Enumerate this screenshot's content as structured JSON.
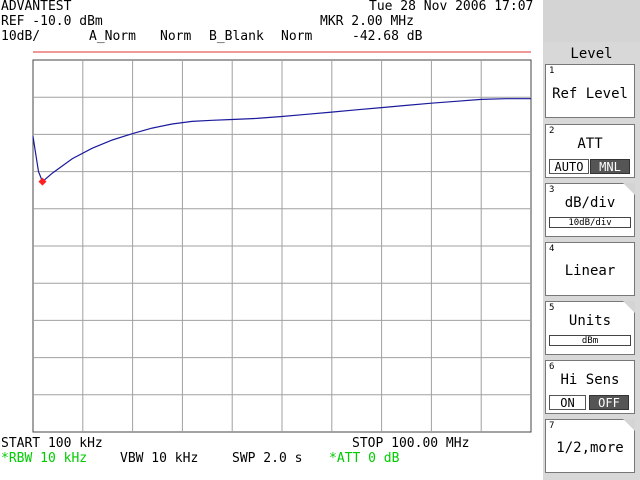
{
  "header": {
    "brand": "ADVANTEST",
    "datetime": "Tue 28 Nov 2006 17:07",
    "ref": "REF -10.0 dBm",
    "mkr": "MKR 2.00 MHz",
    "scale": "10dB/",
    "trace_a": "A_Norm",
    "trace_a_mode": "Norm",
    "trace_b": "B_Blank",
    "trace_b_mode": "Norm",
    "mkr_level": "-42.68 dB"
  },
  "footer": {
    "start": "START 100 kHz",
    "stop": "STOP 100.00 MHz",
    "rbw": "*RBW 10 kHz",
    "vbw": "VBW 10 kHz",
    "swp": "SWP 2.0 s",
    "att": "*ATT 0 dB"
  },
  "menu": {
    "title": "Level",
    "keys": [
      {
        "num": "1",
        "label": "Ref Level"
      },
      {
        "num": "2",
        "label": "ATT",
        "toggle": [
          "AUTO",
          "MNL"
        ],
        "selected": "MNL"
      },
      {
        "num": "3",
        "label": "dB/div",
        "field": "10dB/div"
      },
      {
        "num": "4",
        "label": "Linear"
      },
      {
        "num": "5",
        "label": "Units",
        "field": "dBm"
      },
      {
        "num": "6",
        "label": "Hi Sens",
        "toggle": [
          "ON",
          "OFF"
        ],
        "selected": "OFF"
      },
      {
        "num": "7",
        "label": "1/2,more"
      }
    ]
  },
  "colors": {
    "trace": "#1a1a9c",
    "ref_line": "#e03030",
    "marker": "#ff2020",
    "grid": "#a0a0a0",
    "status_green": "#00cc00"
  },
  "chart_data": {
    "type": "line",
    "x_unit": "MHz",
    "y_unit": "dB",
    "xlim": [
      0.1,
      100.0
    ],
    "ylim": [
      -110,
      -10
    ],
    "grid": true,
    "marker": {
      "x": 2.0,
      "y": -42.68
    },
    "series": [
      {
        "x": [
          0.1,
          0.5,
          1.2,
          2.0,
          4,
          8,
          12,
          16,
          20,
          24,
          28,
          32,
          36,
          40,
          45,
          50,
          55,
          60,
          65,
          70,
          75,
          80,
          85,
          90,
          95,
          100
        ],
        "y": [
          -30.5,
          -34,
          -40,
          -42.68,
          -40.4,
          -36.5,
          -33.7,
          -31.5,
          -29.8,
          -28.3,
          -27.2,
          -26.5,
          -26.2,
          -26.0,
          -25.7,
          -25.2,
          -24.6,
          -24.0,
          -23.4,
          -22.8,
          -22.2,
          -21.6,
          -21.1,
          -20.6,
          -20.4,
          -20.4
        ]
      }
    ]
  }
}
